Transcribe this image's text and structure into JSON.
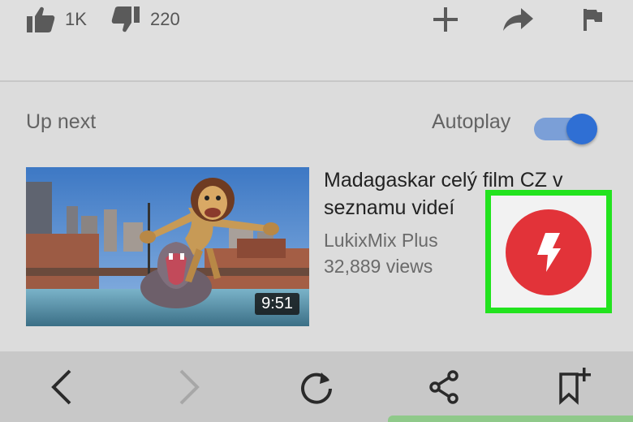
{
  "actions": {
    "like_count": "1K",
    "dislike_count": "220"
  },
  "up_next": {
    "label": "Up next",
    "autoplay_label": "Autoplay",
    "autoplay_on": true
  },
  "video": {
    "title": "Madagaskar celý film CZ v seznamu videí",
    "channel": "LukixMix Plus",
    "views": "32,889 views",
    "duration": "9:51"
  },
  "colors": {
    "highlight": "#22e31e",
    "flash_button": "#e23339",
    "toggle": "#2f6fd4"
  },
  "icons": [
    "thumbs-up-icon",
    "thumbs-down-icon",
    "plus-icon",
    "share-arrow-icon",
    "flag-icon",
    "lightning-icon",
    "back-arrow-icon",
    "forward-arrow-icon",
    "reload-icon",
    "share-icon",
    "bookmark-add-icon"
  ]
}
